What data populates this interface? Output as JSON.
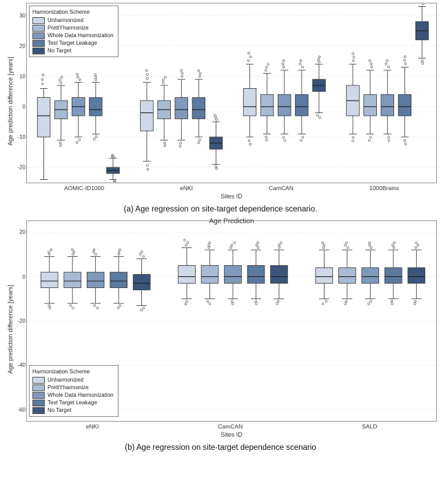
{
  "legend": {
    "title": "Harmonization Scheme",
    "items": [
      {
        "name": "Unharmonized",
        "color": "#cfd8e6"
      },
      {
        "name": "PrettYharmonize",
        "color": "#a9bbd4"
      },
      {
        "name": "Whole Data Harmonization",
        "color": "#7e99bb"
      },
      {
        "name": "Test Target Leakage",
        "color": "#5b7aa0"
      },
      {
        "name": "No Target",
        "color": "#3a5579"
      }
    ]
  },
  "caption_a": "(a) Age regression on site-target dependence scenario.",
  "caption_b": "(b) Age regression on site-target dependence scenario",
  "chart_data": [
    {
      "id": "panel_a",
      "type": "box",
      "title": "",
      "xlabel": "Sites ID",
      "ylabel": "Age prediction difference [years]",
      "ylim": [
        -25,
        34
      ],
      "yticks": [
        -20,
        -10,
        0,
        10,
        20,
        30
      ],
      "categories": [
        "AOMIC-ID1000",
        "eNKI",
        "CamCAN",
        "1000Brains"
      ],
      "series": [
        {
          "name": "Unharmonized",
          "color": "#cfd8e6",
          "boxes": [
            {
              "min": -24,
              "q1": -10,
              "med": -3,
              "q3": 3,
              "max": 6
            },
            {
              "min": -18,
              "q1": -8,
              "med": -2,
              "q3": 2,
              "max": 8
            },
            {
              "min": -10,
              "q1": -3,
              "med": 0,
              "q3": 6,
              "max": 14
            },
            {
              "min": -9,
              "q1": -3,
              "med": 2,
              "q3": 7,
              "max": 14
            }
          ]
        },
        {
          "name": "PrettYharmonize",
          "color": "#a9bbd4",
          "boxes": [
            {
              "min": -11,
              "q1": -4,
              "med": -1,
              "q3": 2,
              "max": 7
            },
            {
              "min": -11,
              "q1": -4,
              "med": -1,
              "q3": 2,
              "max": 7
            },
            {
              "min": -9,
              "q1": -3,
              "med": 0,
              "q3": 4,
              "max": 11
            },
            {
              "min": -9,
              "q1": -3,
              "med": 0,
              "q3": 4,
              "max": 12
            }
          ]
        },
        {
          "name": "Whole Data Harmonization",
          "color": "#7e99bb",
          "boxes": [
            {
              "min": -10,
              "q1": -3,
              "med": 0,
              "q3": 3,
              "max": 8
            },
            {
              "min": -11,
              "q1": -4,
              "med": -1,
              "q3": 3,
              "max": 9
            },
            {
              "min": -9,
              "q1": -3,
              "med": 0,
              "q3": 4,
              "max": 12
            },
            {
              "min": -9,
              "q1": -3,
              "med": 0,
              "q3": 4,
              "max": 12
            }
          ]
        },
        {
          "name": "Test Target Leakage",
          "color": "#5b7aa0",
          "boxes": [
            {
              "min": -9,
              "q1": -3,
              "med": -1,
              "q3": 3,
              "max": 8
            },
            {
              "min": -10,
              "q1": -4,
              "med": -1,
              "q3": 3,
              "max": 9
            },
            {
              "min": -9,
              "q1": -3,
              "med": 0,
              "q3": 4,
              "max": 12
            },
            {
              "min": -10,
              "q1": -3,
              "med": 0,
              "q3": 4,
              "max": 13
            }
          ]
        },
        {
          "name": "No Target",
          "color": "#3a5579",
          "boxes": [
            {
              "min": -24,
              "q1": -22,
              "med": -21,
              "q3": -20,
              "max": -17
            },
            {
              "min": -19,
              "q1": -14,
              "med": -12,
              "q3": -10,
              "max": -5
            },
            {
              "min": -2,
              "q1": 5,
              "med": 7,
              "q3": 9,
              "max": 14
            },
            {
              "min": 16,
              "q1": 22,
              "med": 25,
              "q3": 28,
              "max": 33
            }
          ]
        }
      ],
      "legend_pos": "top-left"
    },
    {
      "id": "panel_b",
      "type": "box",
      "title": "Age Prediction",
      "xlabel": "Sites ID",
      "ylabel": "Age prediction difference [years]",
      "ylim": [
        -65,
        25
      ],
      "yticks": [
        -60,
        -40,
        -20,
        0,
        20
      ],
      "categories": [
        "eNKI",
        "CamCAN",
        "SALD"
      ],
      "series": [
        {
          "name": "Unharmonized",
          "color": "#cfd8e6",
          "boxes": [
            {
              "min": -12,
              "q1": -5,
              "med": -2,
              "q3": 2,
              "max": 9
            },
            {
              "min": -10,
              "q1": -3,
              "med": 0,
              "q3": 5,
              "max": 13
            },
            {
              "min": -10,
              "q1": -3,
              "med": 0,
              "q3": 4,
              "max": 12
            }
          ]
        },
        {
          "name": "PrettYharmonize",
          "color": "#a9bbd4",
          "boxes": [
            {
              "min": -12,
              "q1": -5,
              "med": -2,
              "q3": 2,
              "max": 9
            },
            {
              "min": -10,
              "q1": -3,
              "med": 0,
              "q3": 5,
              "max": 12
            },
            {
              "min": -10,
              "q1": -3,
              "med": 0,
              "q3": 4,
              "max": 12
            }
          ]
        },
        {
          "name": "Whole Data Harmonization",
          "color": "#7e99bb",
          "boxes": [
            {
              "min": -12,
              "q1": -5,
              "med": -2,
              "q3": 2,
              "max": 9
            },
            {
              "min": -10,
              "q1": -3,
              "med": 0,
              "q3": 5,
              "max": 12
            },
            {
              "min": -10,
              "q1": -3,
              "med": 0,
              "q3": 4,
              "max": 12
            }
          ]
        },
        {
          "name": "Test Target Leakage",
          "color": "#5b7aa0",
          "boxes": [
            {
              "min": -12,
              "q1": -5,
              "med": -2,
              "q3": 2,
              "max": 9
            },
            {
              "min": -10,
              "q1": -3,
              "med": 0,
              "q3": 5,
              "max": 12
            },
            {
              "min": -10,
              "q1": -3,
              "med": 0,
              "q3": 4,
              "max": 12
            }
          ]
        },
        {
          "name": "No Target",
          "color": "#3a5579",
          "boxes": [
            {
              "min": -13,
              "q1": -6,
              "med": -3,
              "q3": 1,
              "max": 8
            },
            {
              "min": -10,
              "q1": -3,
              "med": 0,
              "q3": 5,
              "max": 12
            },
            {
              "min": -10,
              "q1": -3,
              "med": 0,
              "q3": 4,
              "max": 12
            }
          ]
        }
      ],
      "legend_pos": "bottom-left"
    }
  ]
}
